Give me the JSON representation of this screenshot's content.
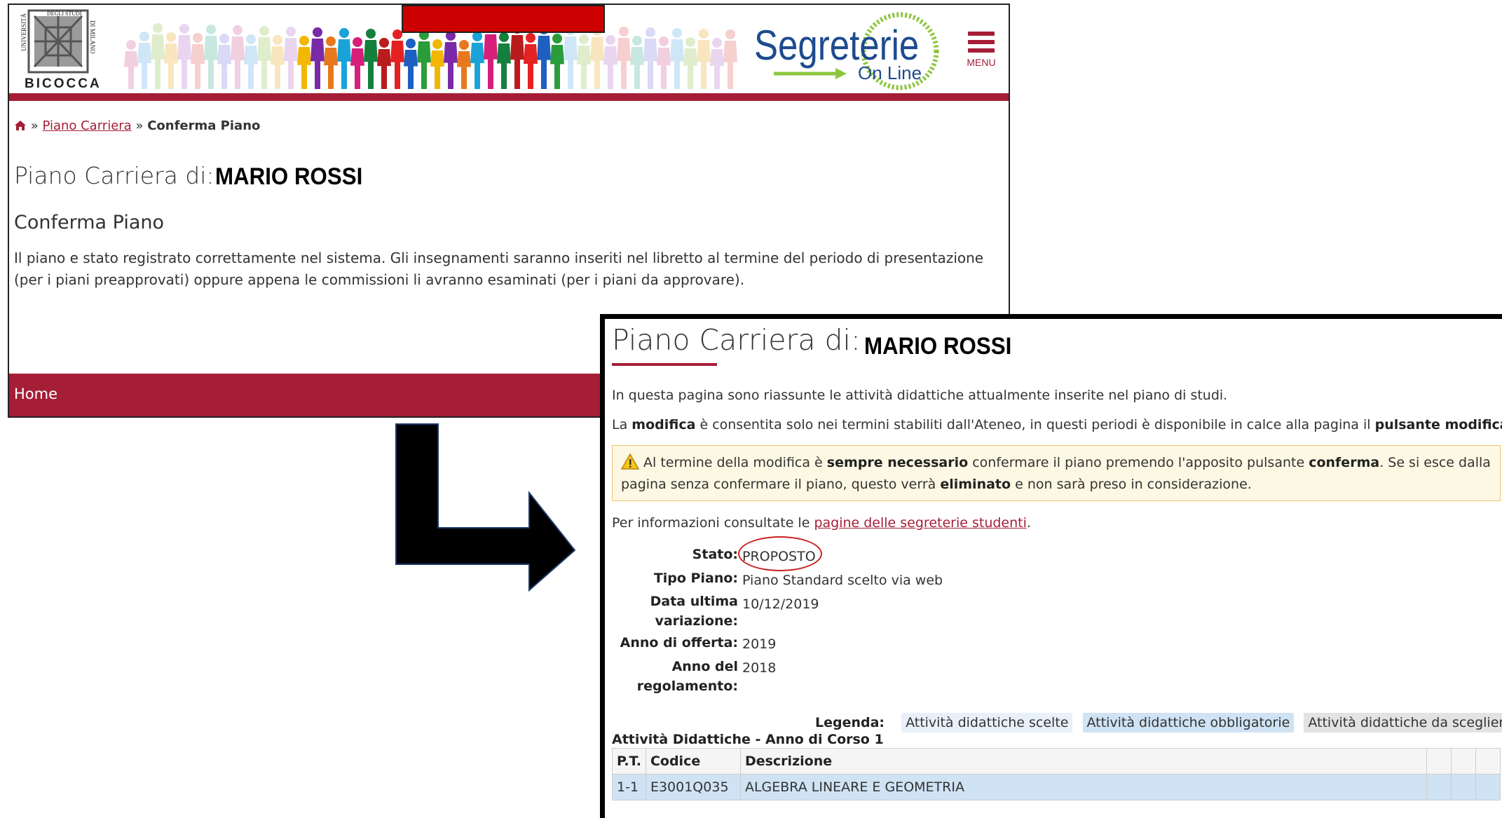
{
  "colors": {
    "accent": "#a51e36",
    "redaction": "#cc0000",
    "warning_bg": "#fcf8e3",
    "highlight_circle": "#cc1f1f"
  },
  "screen1": {
    "logo": {
      "line1": "UNIVERSITÀ",
      "line2": "DEGLI STUDI",
      "line3": "DI MILANO",
      "name": "BICOCCA"
    },
    "brand": {
      "text": "Segreterie",
      "sub": "On Line"
    },
    "menu_label": "MENU",
    "breadcrumb": {
      "home_icon": "home-icon",
      "sep": "»",
      "link": "Piano Carriera",
      "current": "Conferma Piano"
    },
    "title": "Piano Carriera di:",
    "student_name": "MARIO ROSSI",
    "subtitle": "Conferma Piano",
    "message": "Il piano e stato registrato correttamente nel sistema. Gli insegnamenti saranno inseriti nel libretto al termine del periodo di presentazione (per i piani preapprovati) oppure appena le commissioni li avranno esaminati (per i piani da approvare).",
    "footer_home": "Home"
  },
  "screen2": {
    "title": "Piano Carriera di:",
    "student_name": "MARIO ROSSI",
    "intro": "In questa pagina sono riassunte le attività didattiche attualmente inserite nel piano di studi.",
    "mod": {
      "p1": "La ",
      "b1": "modifica",
      "p2": " è consentita solo nei termini stabiliti dall'Ateneo, in questi periodi è disponibile in calce alla pagina il ",
      "b2": "pulsante modifica",
      "p3": "."
    },
    "warning": {
      "icon": "warning-icon",
      "p1": "Al termine della modifica è ",
      "b1": "sempre necessario",
      "p2": " confermare il piano premendo l'apposito pulsante ",
      "b2": "conferma",
      "p3": ". Se si esce dalla pagina senza confermare il piano, questo verrà ",
      "b3": "eliminato",
      "p4": " e non sarà preso in considerazione."
    },
    "info": {
      "text": "Per informazioni consultate le ",
      "link": "pagine delle segreterie studenti",
      "end": "."
    },
    "fields": {
      "stato_label": "Stato:",
      "stato_value": "PROPOSTO",
      "tipo_label": "Tipo Piano:",
      "tipo_value": "Piano Standard scelto via web",
      "data_label_1": "Data ultima",
      "data_label_2": "variazione:",
      "data_value": "10/12/2019",
      "anno_off_label": "Anno di offerta:",
      "anno_off_value": "2019",
      "anno_reg_label_1": "Anno del",
      "anno_reg_label_2": "regolamento:",
      "anno_reg_value": "2018"
    },
    "legend": {
      "label": "Legenda:",
      "scelte": "Attività didattiche scelte",
      "obbligatorie": "Attività didattiche obbligatorie",
      "scegliere": "Attività didattiche da scegliere"
    },
    "section": "Attività Didattiche - Anno di Corso 1",
    "table": {
      "headers": {
        "pt": "P.T.",
        "codice": "Codice",
        "descrizione": "Descrizione"
      },
      "rows": [
        {
          "pt": "1-1",
          "codice": "E3001Q035",
          "descrizione": "ALGEBRA LINEARE E GEOMETRIA"
        }
      ]
    }
  }
}
